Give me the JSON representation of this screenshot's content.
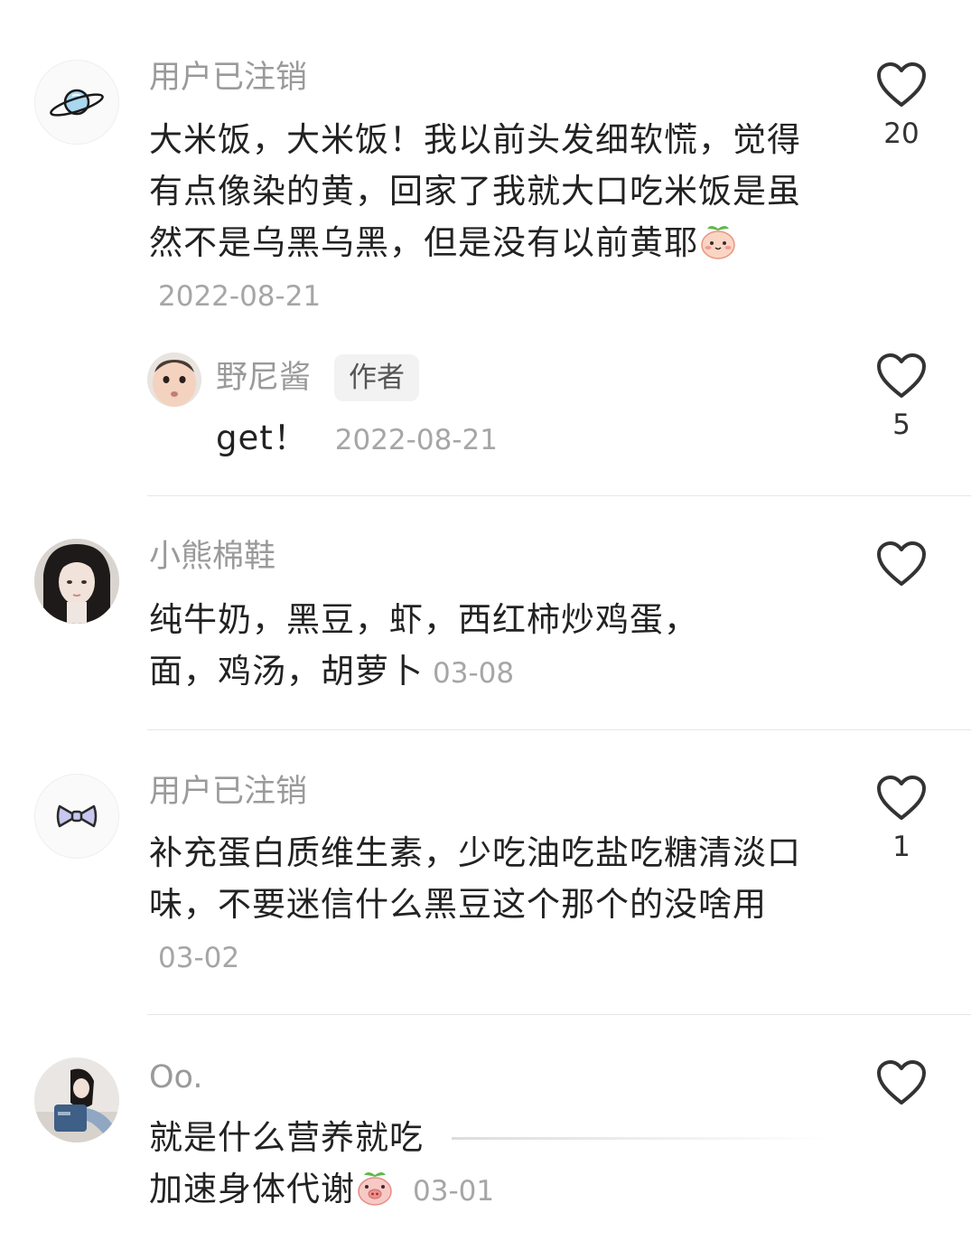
{
  "comments": [
    {
      "user": "用户已注销",
      "avatar_icon": "planet-icon",
      "text": "大米饭，大米饭！我以前头发细软慌，觉得有点像染的黄，回家了我就大口吃米饭是虽然不是乌黑乌黑，但是没有以前黄耶",
      "emoji_icon": "peach-face-emoji",
      "time": "2022-08-21",
      "likes": "20",
      "reply": {
        "user": "野尼酱",
        "badge": "作者",
        "avatar_icon": "baby-face-avatar",
        "text": "get！",
        "time": "2022-08-21",
        "likes": "5"
      }
    },
    {
      "user": "小熊棉鞋",
      "avatar_icon": "girl-photo-avatar",
      "text": "纯牛奶，黑豆，虾，西红柿炒鸡蛋，面，鸡汤，胡萝卜",
      "time": "03-08",
      "likes": ""
    },
    {
      "user": "用户已注销",
      "avatar_icon": "bow-icon",
      "text": "补充蛋白质维生素，少吃油吃盐吃糖清淡口味，不要迷信什么黑豆这个那个的没啥用",
      "time": "03-02",
      "likes": "1"
    },
    {
      "user": "Oo.",
      "avatar_icon": "girl-photo-avatar",
      "text_line1": "就是什么营养就吃",
      "text_line2": "加速身体代谢",
      "emoji_icon": "pig-face-emoji",
      "time": "03-01",
      "likes": ""
    }
  ],
  "colors": {
    "name_gray": "#9a9a9a",
    "text": "#222222",
    "time_gray": "#a6a6a6",
    "divider": "#e7e7e7",
    "heart_outline": "#333333"
  }
}
